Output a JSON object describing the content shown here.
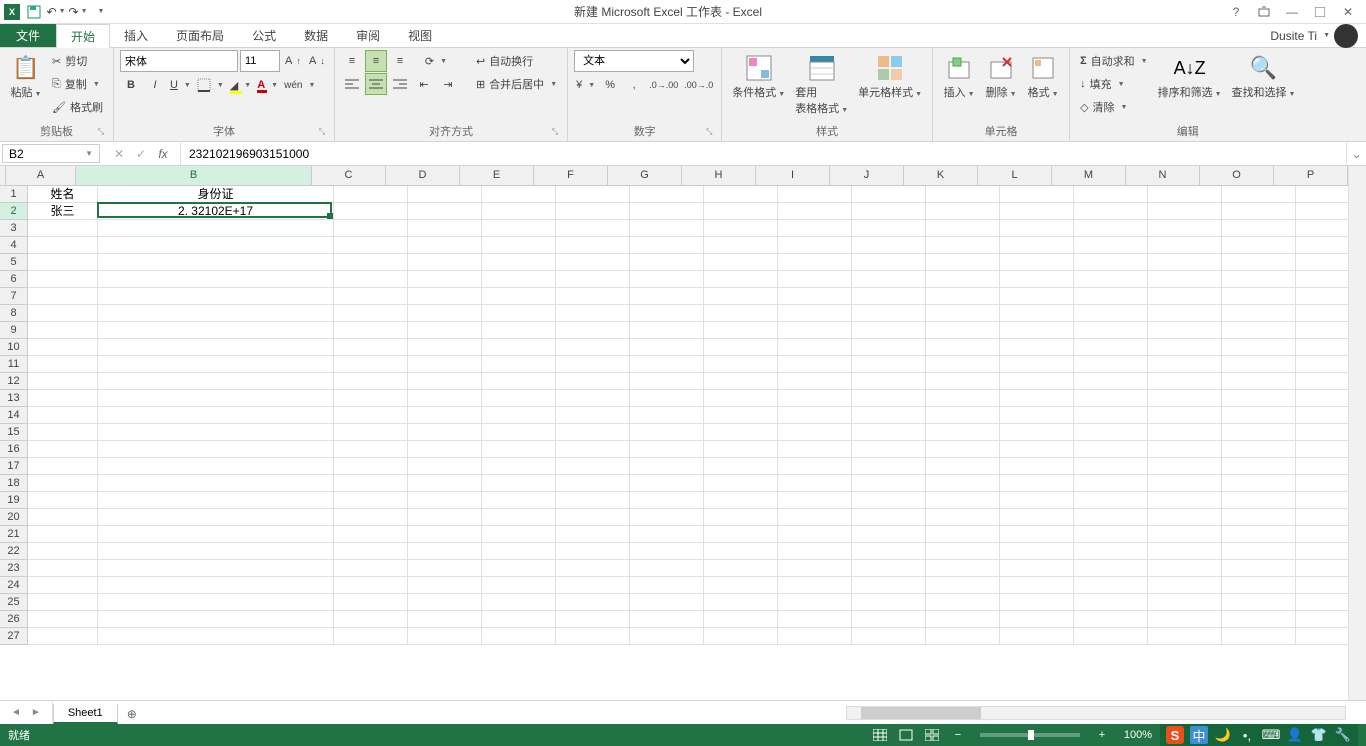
{
  "title": "新建 Microsoft Excel 工作表 - Excel",
  "user": "Dusite Ti",
  "tabs": {
    "file": "文件",
    "items": [
      "开始",
      "插入",
      "页面布局",
      "公式",
      "数据",
      "审阅",
      "视图"
    ],
    "active": 0
  },
  "ribbon": {
    "clipboard": {
      "label": "剪贴板",
      "paste": "粘贴",
      "cut": "剪切",
      "copy": "复制",
      "format_painter": "格式刷"
    },
    "font": {
      "label": "字体",
      "name": "宋体",
      "size": "11"
    },
    "align": {
      "label": "对齐方式",
      "wrap": "自动换行",
      "merge": "合并后居中"
    },
    "number": {
      "label": "数字",
      "format": "文本"
    },
    "styles": {
      "label": "样式",
      "cond": "条件格式",
      "table": "套用\n表格格式",
      "cell": "单元格样式"
    },
    "cells": {
      "label": "单元格",
      "insert": "插入",
      "delete": "删除",
      "format": "格式"
    },
    "editing": {
      "label": "编辑",
      "sum": "自动求和",
      "fill": "填充",
      "clear": "清除",
      "sort": "排序和筛选",
      "find": "查找和选择"
    }
  },
  "formula_bar": {
    "cell_ref": "B2",
    "formula": "232102196903151000"
  },
  "grid": {
    "columns": [
      "A",
      "B",
      "C",
      "D",
      "E",
      "F",
      "G",
      "H",
      "I",
      "J",
      "K",
      "L",
      "M",
      "N",
      "O",
      "P"
    ],
    "col_widths": {
      "A": 70,
      "B": 236,
      "default": 74
    },
    "row_count": 27,
    "selected_col": "B",
    "selected_row": 2,
    "cells": {
      "A1": "姓名",
      "B1": "身份证",
      "A2": "张三",
      "B2": "2. 32102E+17"
    }
  },
  "sheets": {
    "active": "Sheet1",
    "tabs": [
      "Sheet1"
    ]
  },
  "status": {
    "ready": "就绪",
    "zoom": "100%"
  },
  "ime": "中"
}
